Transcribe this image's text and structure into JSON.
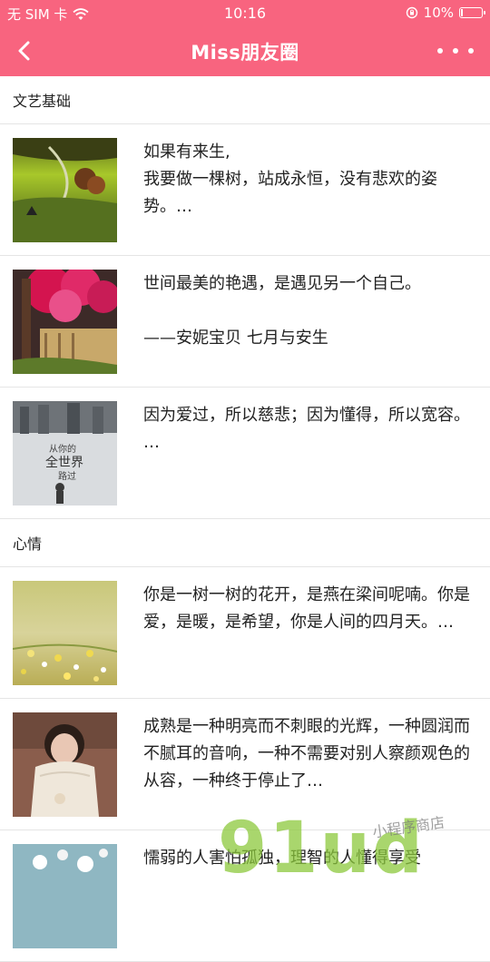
{
  "status_bar": {
    "carrier": "无 SIM 卡",
    "time": "10:16",
    "battery": "10%",
    "battery_level": 0.1
  },
  "nav": {
    "title": "Miss朋友圈"
  },
  "sections": [
    {
      "title": "文艺基础",
      "items": [
        {
          "text": "如果有来生,\n我要做一棵树，站成永恒，没有悲欢的姿势。…",
          "image": "green-landscape"
        },
        {
          "text": "世间最美的艳遇，是遇见另一个自己。\n\n——安妮宝贝 七月与安生",
          "image": "pink-blossom-tree"
        },
        {
          "text": "因为爱过，所以慈悲；因为懂得，所以宽容。\n…",
          "image": "book-cover",
          "image_text": [
            "从你的",
            "全世界",
            "路过"
          ]
        }
      ]
    },
    {
      "title": "心情",
      "items": [
        {
          "text": "你是一树一树的花开，是燕在梁间呢喃。你是爱，是暖，是希望，你是人间的四月天。…",
          "image": "yellow-flowers"
        },
        {
          "text": "成熟是一种明亮而不刺眼的光辉，一种圆润而不腻耳的音响，一种不需要对别人察颜观色的从容，一种终于停止了…",
          "image": "child-portrait"
        },
        {
          "text": "懦弱的人害怕孤独，理智的人懂得享受",
          "image": "blue-flowers"
        }
      ]
    }
  ],
  "watermark": {
    "big": "91ud",
    "small": "小程序商店"
  }
}
